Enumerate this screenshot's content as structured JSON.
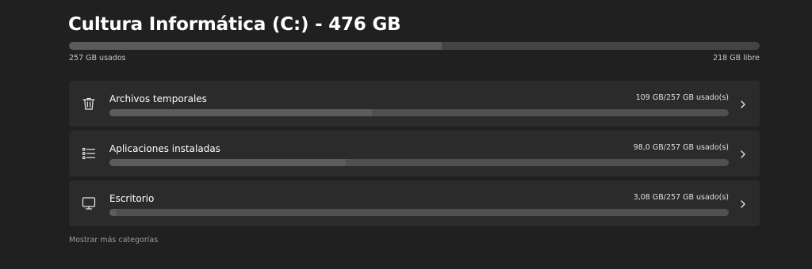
{
  "drive": {
    "title": "Cultura Informática (C:) - 476 GB",
    "used_label": "257 GB usados",
    "free_label": "218 GB libre",
    "used_fraction": 0.54
  },
  "categories": [
    {
      "label": "Archivos temporales",
      "usage": "109 GB/257 GB usado(s)",
      "fraction": 0.424,
      "icon": "trash-icon"
    },
    {
      "label": "Aplicaciones instaladas",
      "usage": "98,0 GB/257 GB usado(s)",
      "fraction": 0.381,
      "icon": "list-icon"
    },
    {
      "label": "Escritorio",
      "usage": "3,08 GB/257 GB usado(s)",
      "fraction": 0.012,
      "icon": "monitor-icon"
    }
  ],
  "more_link": "Mostrar más categorías",
  "colors": {
    "background": "#202020",
    "card": "#2b2b2b",
    "bar_track": "#505050",
    "bar_fill": "#5c5c5c"
  }
}
